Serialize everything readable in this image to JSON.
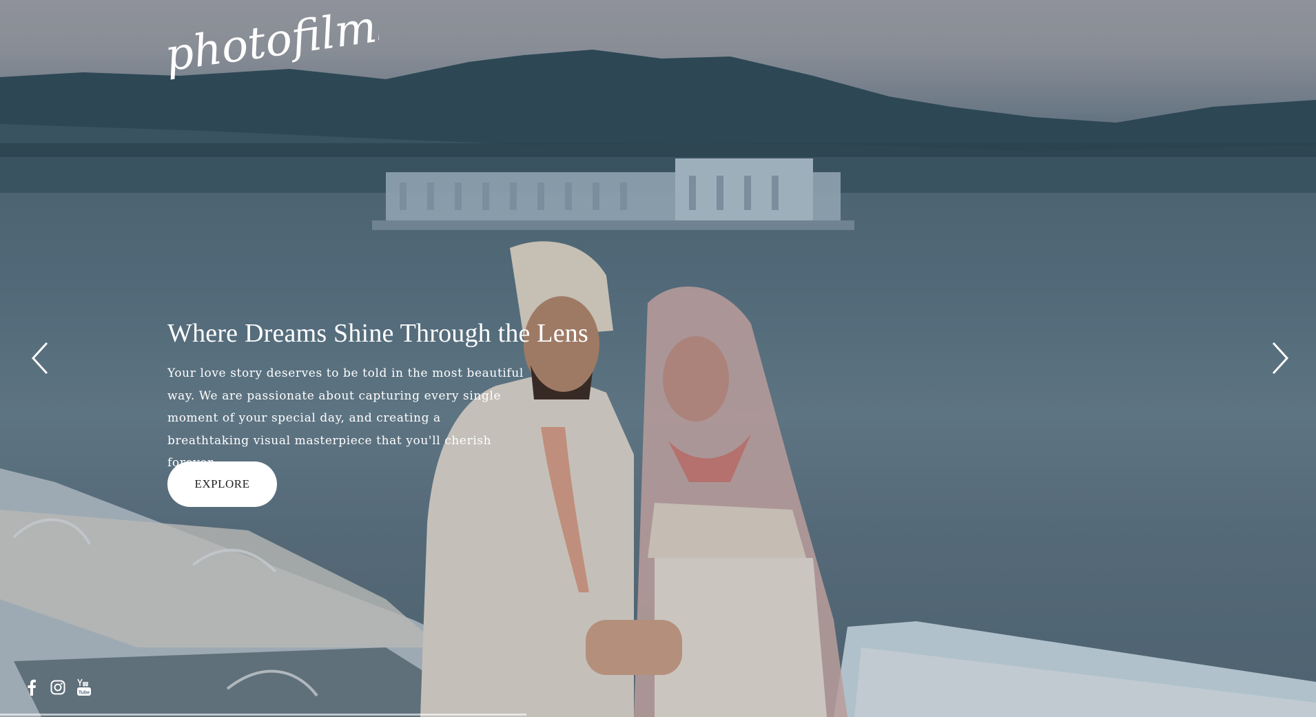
{
  "brand": {
    "logo_text": "photofilms"
  },
  "hero": {
    "headline": "Where Dreams Shine Through the Lens",
    "description": "Your love story deserves to be told in the most beautiful way. We are passionate about capturing every single moment of your special day, and creating a breathtaking visual masterpiece that you'll cherish forever.",
    "cta_label": "EXPLORE",
    "slide_progress": 0.4
  },
  "navigation": {
    "prev_icon": "chevron-left-icon",
    "next_icon": "chevron-right-icon"
  },
  "socials": [
    {
      "name": "facebook-icon"
    },
    {
      "name": "instagram-icon"
    },
    {
      "name": "youtube-icon"
    }
  ],
  "colors": {
    "text": "#ffffff",
    "button_bg": "#ffffff",
    "button_text": "#1f1f1f"
  }
}
